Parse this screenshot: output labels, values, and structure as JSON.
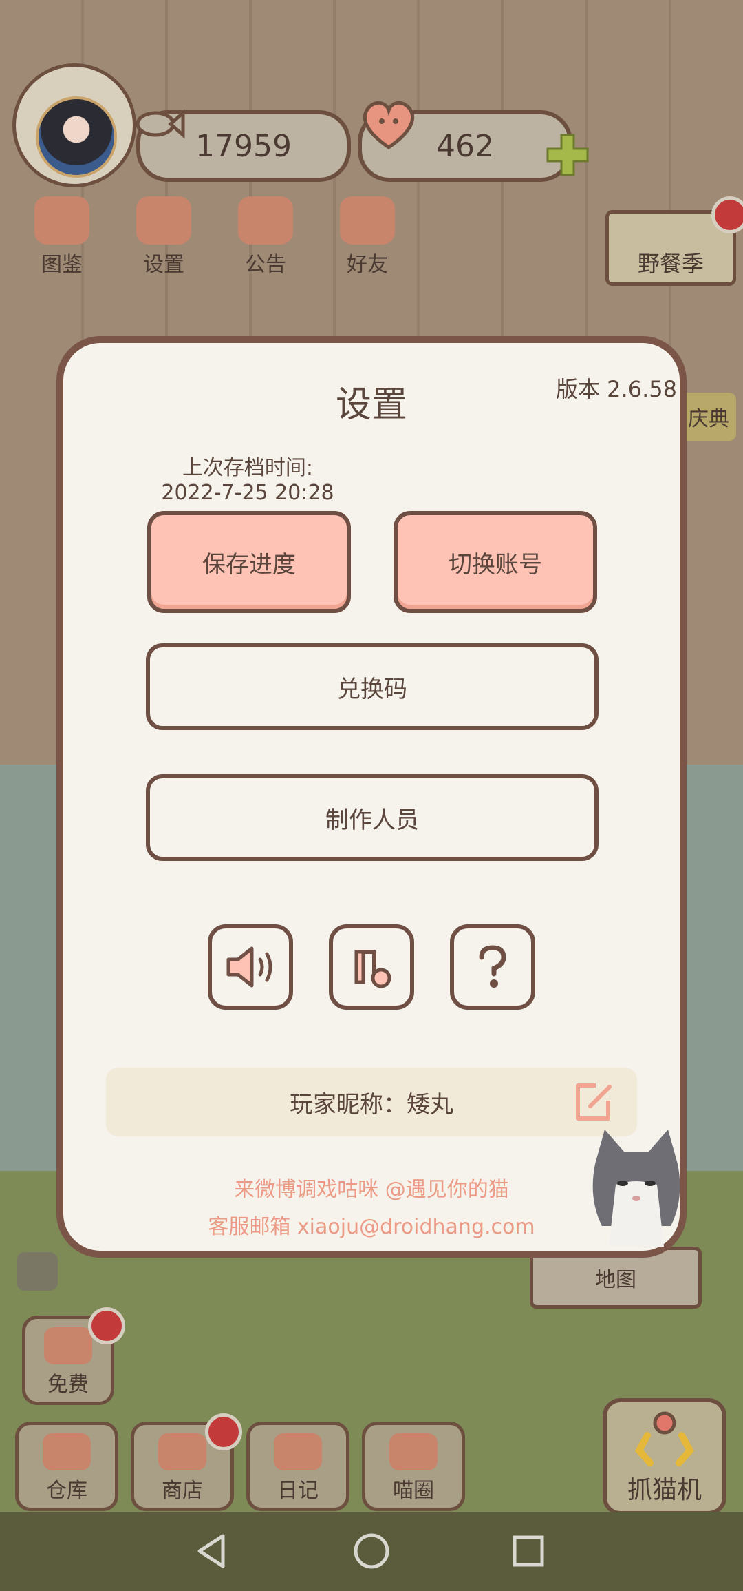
{
  "hud": {
    "coins": "17959",
    "hearts": "462",
    "menu": [
      {
        "label": "图鉴",
        "icon": "cat-face-icon"
      },
      {
        "label": "设置",
        "icon": "gear-icon"
      },
      {
        "label": "公告",
        "icon": "gift-icon"
      },
      {
        "label": "好友",
        "icon": "friends-icon"
      }
    ],
    "picnic_label": "野餐季",
    "festival_label": "庆典"
  },
  "dialog": {
    "title": "设置",
    "version": "版本 2.6.58",
    "save_time_label": "上次存档时间:",
    "save_time_value": "2022-7-25 20:28",
    "save_button": "保存进度",
    "switch_account_button": "切换账号",
    "redeem_button": "兑换码",
    "credits_button": "制作人员",
    "icon_buttons": [
      "speaker-icon",
      "music-note-icon",
      "help-icon"
    ],
    "nickname": "玩家昵称：矮丸",
    "weibo_line": "来微博调戏咕咪 @遇见你的猫",
    "email_line": "客服邮箱 xiaoju@droidhang.com"
  },
  "bottom": {
    "free_label": "免费",
    "map_label": "地图",
    "tabs": [
      "仓库",
      "商店",
      "日记",
      "喵圈"
    ],
    "claw_label": "抓猫机"
  },
  "colors": {
    "accent_pink": "#ffc3b5",
    "border_brown": "#6f4f43",
    "link_salmon": "#eb9b85",
    "badge_red": "#c23a3a"
  }
}
